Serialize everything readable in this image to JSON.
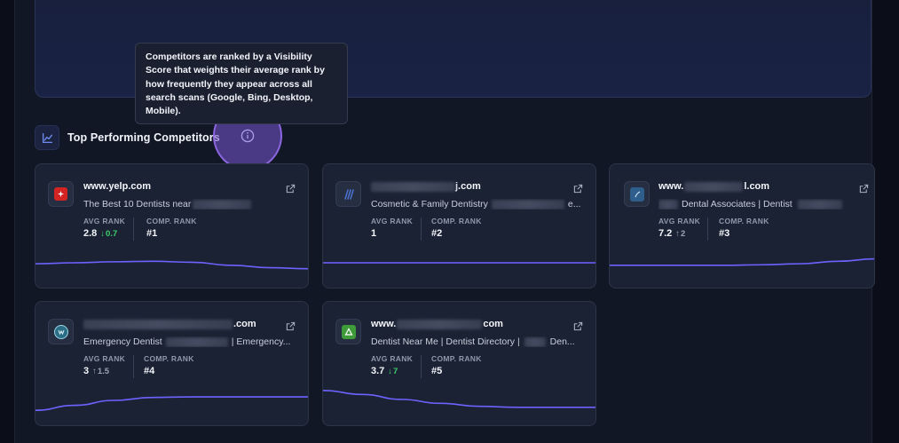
{
  "tooltip": {
    "text": "Competitors are ranked by a Visibility Score that weights their average rank by how frequently they appear across all search scans (Google, Bing, Desktop, Mobile)."
  },
  "section": {
    "title": "Top Performing Competitors",
    "icon": "chart-line-icon",
    "info_icon": "info-icon"
  },
  "labels": {
    "avg_rank": "AVG RANK",
    "comp_rank": "COMP. RANK"
  },
  "colors": {
    "accent": "#6c63ff",
    "good": "#3ecf6a",
    "card_bg": "#1b2233"
  },
  "competitors": [
    {
      "domain": "www.yelp.com",
      "subtitle": "The Best 10 Dentists near",
      "avg_rank": "2.8",
      "delta": "0.7",
      "delta_dir": "down",
      "comp_rank": "#1",
      "trend": [
        0.52,
        0.5,
        0.48,
        0.47,
        0.49,
        0.55,
        0.6,
        0.62
      ]
    },
    {
      "domain_suffix": "j.com",
      "subtitle": "Cosmetic & Family Dentistry",
      "subtitle_tail": "e...",
      "avg_rank": "1",
      "delta": "",
      "delta_dir": "none",
      "comp_rank": "#2",
      "trend": [
        0.5,
        0.5,
        0.5,
        0.5,
        0.5,
        0.5,
        0.5,
        0.5
      ]
    },
    {
      "domain_prefix": "www.",
      "domain_suffix": "l.com",
      "subtitle": "Dental Associates | Dentist",
      "avg_rank": "7.2",
      "delta": "2",
      "delta_dir": "up",
      "comp_rank": "#3",
      "trend": [
        0.55,
        0.55,
        0.55,
        0.55,
        0.54,
        0.52,
        0.47,
        0.42
      ]
    },
    {
      "domain_suffix": ".com",
      "subtitle": "Emergency Dentist",
      "subtitle_tail": "| Emergency...",
      "avg_rank": "3",
      "delta": "1.5",
      "delta_dir": "up",
      "comp_rank": "#4",
      "trend": [
        0.7,
        0.6,
        0.5,
        0.44,
        0.43,
        0.43,
        0.43,
        0.43
      ]
    },
    {
      "domain_prefix": "www.",
      "domain_suffix": "com",
      "subtitle": "Dentist Near Me | Dentist Directory |",
      "subtitle_tail": "Den...",
      "avg_rank": "3.7",
      "delta": "7",
      "delta_dir": "down",
      "comp_rank": "#5",
      "trend": [
        0.3,
        0.38,
        0.48,
        0.56,
        0.62,
        0.64,
        0.64,
        0.64
      ]
    }
  ]
}
